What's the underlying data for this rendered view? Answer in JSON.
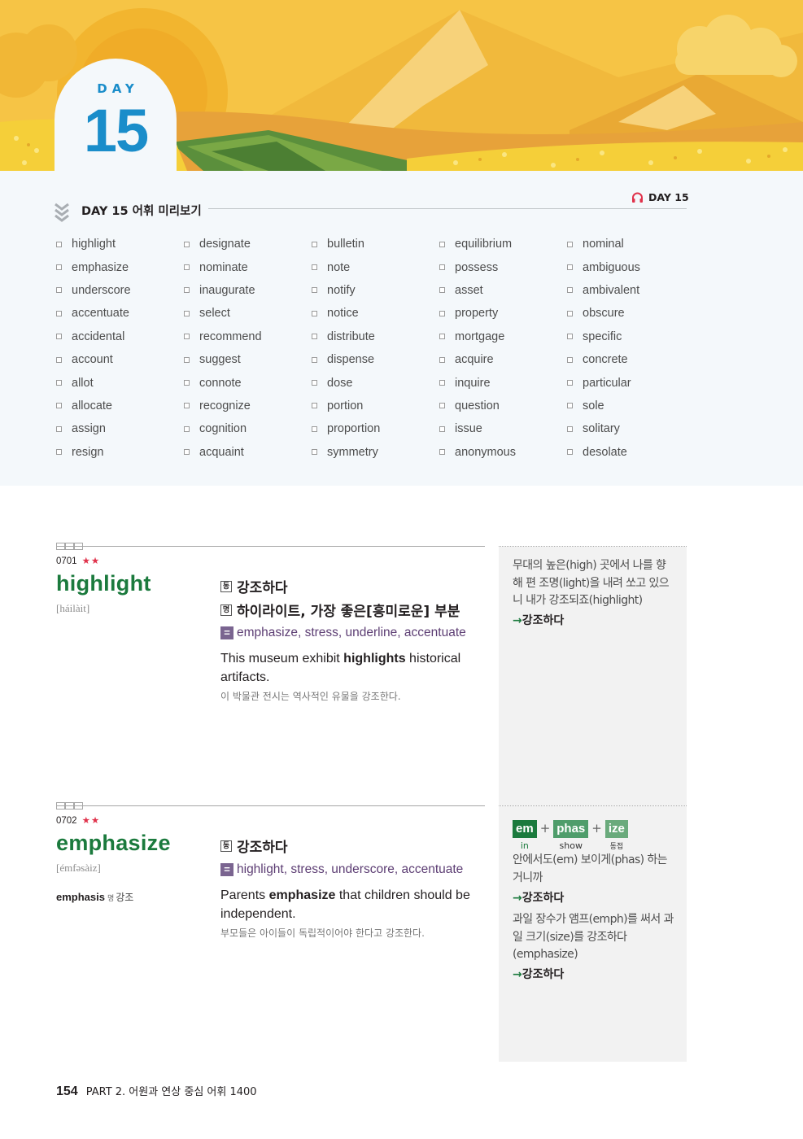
{
  "banner": {
    "day_word": "DAY",
    "day_number": "15"
  },
  "preview": {
    "title": "DAY 15 어휘 미리보기",
    "audio_label": "DAY 15",
    "columns": [
      [
        "highlight",
        "emphasize",
        "underscore",
        "accentuate",
        "accidental",
        "account",
        "allot",
        "allocate",
        "assign",
        "resign"
      ],
      [
        "designate",
        "nominate",
        "inaugurate",
        "select",
        "recommend",
        "suggest",
        "connote",
        "recognize",
        "cognition",
        "acquaint"
      ],
      [
        "bulletin",
        "note",
        "notify",
        "notice",
        "distribute",
        "dispense",
        "dose",
        "portion",
        "proportion",
        "symmetry"
      ],
      [
        "equilibrium",
        "possess",
        "asset",
        "property",
        "mortgage",
        "acquire",
        "inquire",
        "question",
        "issue",
        "anonymous"
      ],
      [
        "nominal",
        "ambiguous",
        "ambivalent",
        "obscure",
        "specific",
        "concrete",
        "particular",
        "sole",
        "solitary",
        "desolate"
      ]
    ]
  },
  "entries": [
    {
      "number": "0701",
      "stars": "★★",
      "word": "highlight",
      "pron": "[háilàit]",
      "meanings": [
        {
          "pos": "동",
          "text": "강조하다"
        },
        {
          "pos": "명",
          "text": "하이라이트, 가장 좋은[흥미로운] 부분"
        }
      ],
      "synonyms_sign": "=",
      "synonyms": "emphasize, stress, underline, accentuate",
      "example_pre": "This museum exhibit ",
      "example_bold": "highlights",
      "example_post": " historical artifacts.",
      "example_ko": "이 박물관 전시는 역사적인 유물을 강조한다.",
      "side": {
        "text": "무대의 높은(high) 곳에서 나를 향해 편 조명(light)을 내려 쏘고 있으니 내가 강조되죠(highlight)",
        "arrow": "→",
        "result": "강조하다"
      }
    },
    {
      "number": "0702",
      "stars": "★★",
      "word": "emphasize",
      "pron": "[émfəsàiz]",
      "derivative": {
        "word": "emphasis",
        "pos": "명",
        "meaning": "강조"
      },
      "meanings": [
        {
          "pos": "동",
          "text": "강조하다"
        }
      ],
      "synonyms_sign": "=",
      "synonyms": "highlight, stress, underscore, accentuate",
      "example_pre": "Parents ",
      "example_bold": "emphasize",
      "example_post": " that children should be independent.",
      "example_ko": "부모들은 아이들이 독립적이어야 한다고 강조한다.",
      "side": {
        "morph": [
          {
            "part": "em",
            "gloss": "in",
            "color": "#1b7a3d"
          },
          {
            "part": "phas",
            "gloss": "show",
            "color": "#4f9d6b"
          },
          {
            "part": "ize",
            "gloss": "동접",
            "color": "#6aaa7c"
          }
        ],
        "plus": "+",
        "text1": "안에서도(em) 보이게(phas) 하는 거니까",
        "result1": "강조하다",
        "text2": "과일 장수가 앰프(emph)를 써서 과일 크기(size)를 강조하다(emphasize)",
        "result2": "강조하다",
        "arrow": "→"
      }
    }
  ],
  "footer": {
    "page": "154",
    "part": "PART 2. 어원과 연상 중심 어휘 1400"
  },
  "colors": {
    "accent_blue": "#1a8dca",
    "headword_green": "#1b7a3d",
    "synonym_purple": "#5c3d73",
    "star_red": "#e0324b"
  }
}
